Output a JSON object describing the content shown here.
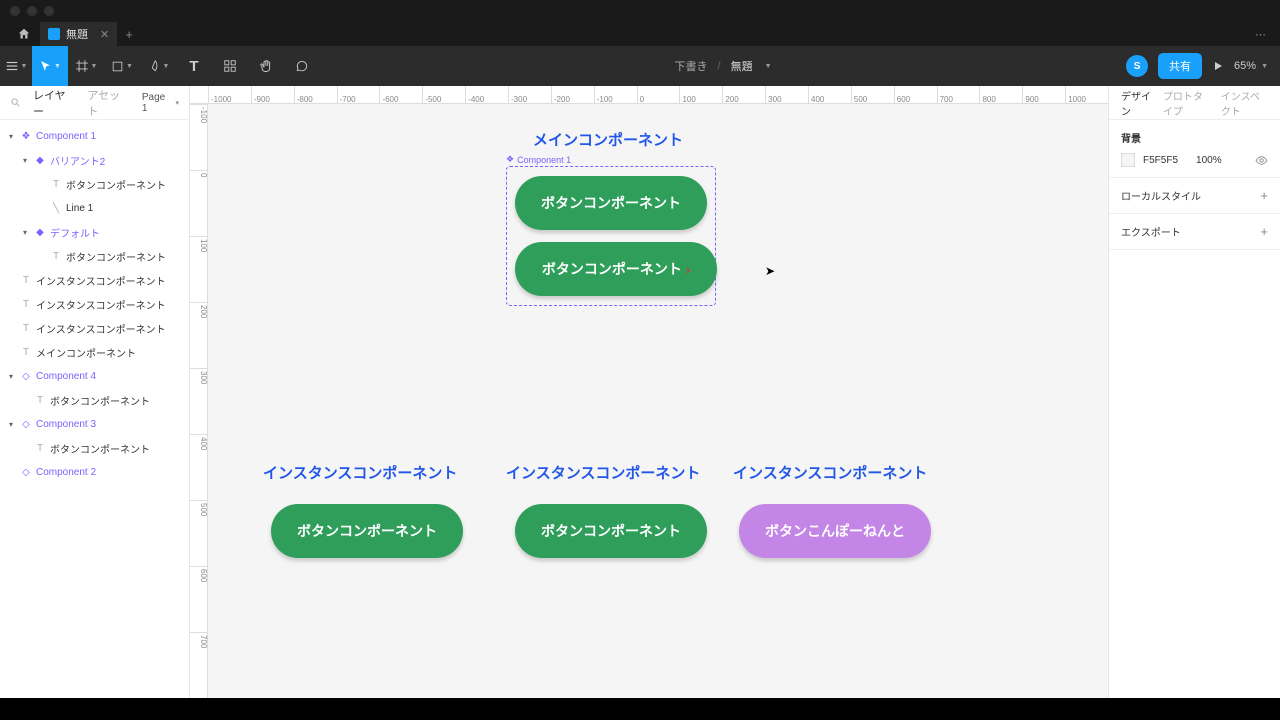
{
  "tabbar": {
    "file_title": "無題"
  },
  "toolbar": {
    "draft_label": "下書き",
    "file_title": "無題",
    "avatar_initial": "S",
    "share_label": "共有",
    "zoom_label": "65%"
  },
  "left_panel": {
    "tab_layers": "レイヤー",
    "tab_assets": "アセット",
    "page_label": "Page 1",
    "layers": {
      "0": "Component 1",
      "1": "バリアント2",
      "2": "ボタンコンポーネント",
      "3": "Line 1",
      "4": "デフォルト",
      "5": "ボタンコンポーネント",
      "6": "インスタンスコンポーネント",
      "7": "インスタンスコンポーネント",
      "8": "インスタンスコンポーネント",
      "9": "メインコンポーネント",
      "10": "Component 4",
      "11": "ボタンコンポーネント",
      "12": "Component 3",
      "13": "ボタンコンポーネント",
      "14": "Component 2"
    }
  },
  "rulers": {
    "h": [
      "-1000",
      "-900",
      "-800",
      "-700",
      "-600",
      "-500",
      "-400",
      "-300",
      "-200",
      "-100",
      "0",
      "100",
      "200",
      "300",
      "400",
      "500",
      "600",
      "700",
      "800",
      "900",
      "1000"
    ],
    "v": [
      "-100",
      "0",
      "100",
      "200",
      "300",
      "400",
      "500",
      "600",
      "700"
    ]
  },
  "canvas": {
    "main_label": "メインコンポーネント",
    "component1_label": "Component 1",
    "button_label": "ボタンコンポーネント",
    "instance_label": "インスタンスコンポーネント",
    "purple_button_label": "ボタンこんぽーねんと"
  },
  "right_panel": {
    "tab_design": "デザイン",
    "tab_prototype": "プロトタイプ",
    "tab_inspect": "インスペクト",
    "bg_title": "背景",
    "bg_value": "F5F5F5",
    "bg_opacity": "100%",
    "local_styles": "ローカルスタイル",
    "export": "エクスポート"
  }
}
